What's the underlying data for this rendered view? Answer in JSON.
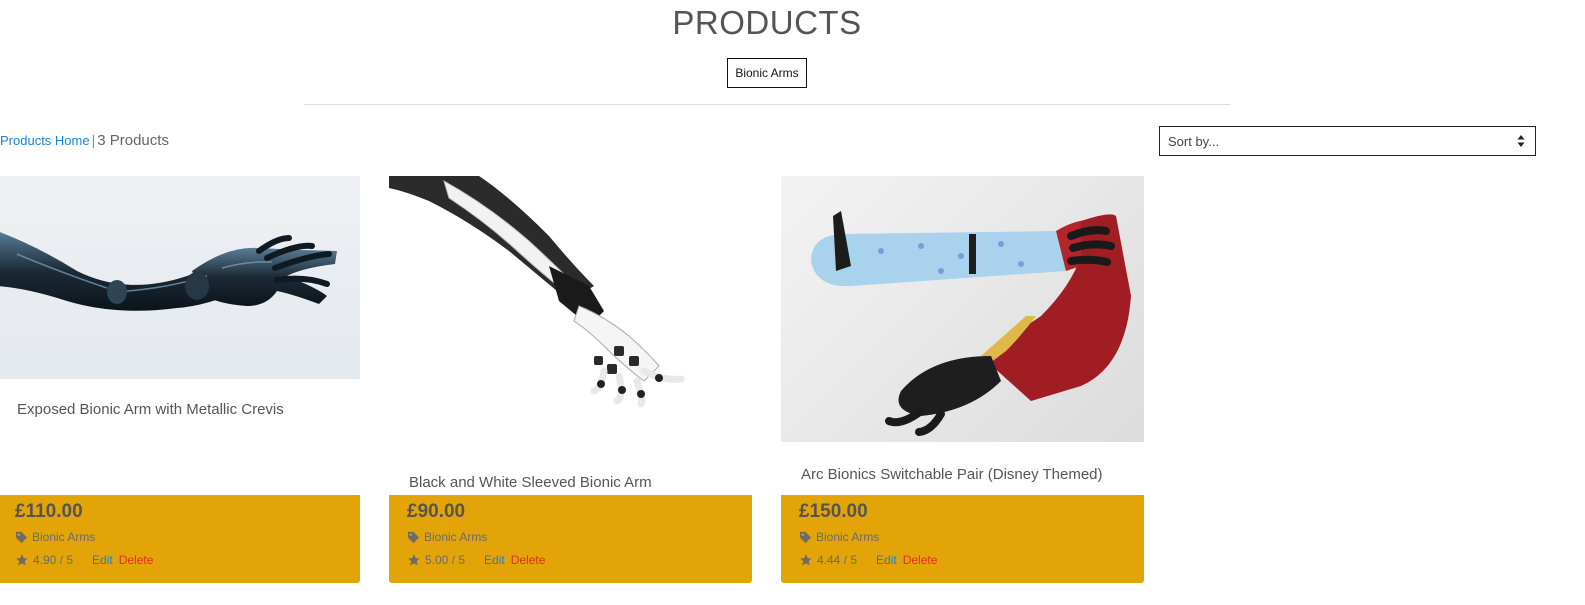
{
  "page": {
    "title": "PRODUCTS",
    "category_badge": "Bionic Arms"
  },
  "breadcrumb": {
    "home_link": "Products Home",
    "separator": "|",
    "count_text": "3 Products"
  },
  "sort": {
    "selected": "Sort by..."
  },
  "colors": {
    "footer_bg": "#e2a406",
    "link": "#1a7fd8",
    "delete": "#e0301e"
  },
  "products": [
    {
      "name": "Exposed Bionic Arm with Metallic Crevis",
      "price": "£110.00",
      "category": "Bionic Arms",
      "rating": "4.90 / 5",
      "edit_label": "Edit",
      "delete_label": "Delete",
      "image_icon": "bionic-arm-metallic-image"
    },
    {
      "name": "Black and White Sleeved Bionic Arm",
      "price": "£90.00",
      "category": "Bionic Arms",
      "rating": "5.00 / 5",
      "edit_label": "Edit",
      "delete_label": "Delete",
      "image_icon": "bionic-arm-white-image"
    },
    {
      "name": "Arc Bionics Switchable Pair (Disney Themed)",
      "price": "£150.00",
      "category": "Bionic Arms",
      "rating": "4.44 / 5",
      "edit_label": "Edit",
      "delete_label": "Delete",
      "image_icon": "bionic-arm-pair-image"
    }
  ]
}
